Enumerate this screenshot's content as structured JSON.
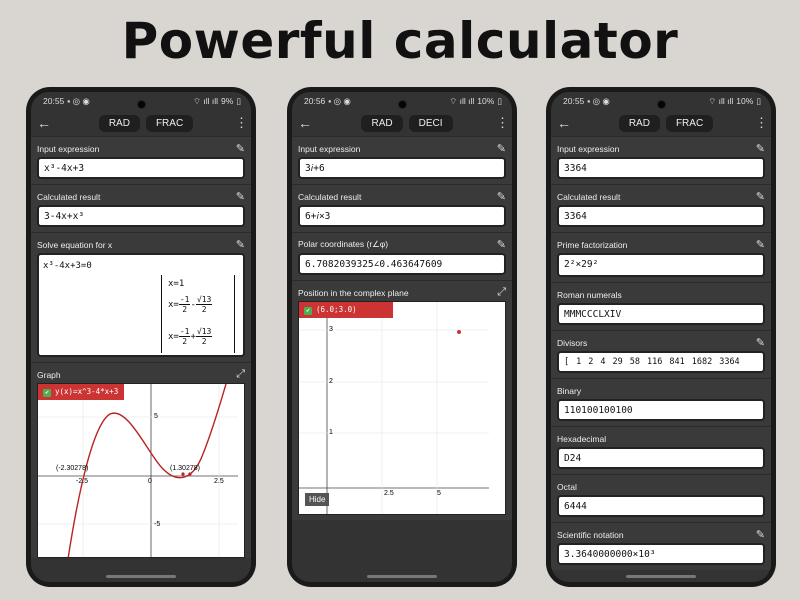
{
  "headline": "Powerful calculator",
  "phone1": {
    "status": {
      "time": "20:55",
      "battery": "9%"
    },
    "mode_buttons": [
      "RAD",
      "FRAC"
    ],
    "input_label": "Input expression",
    "input_value": "x³-4x+3",
    "result_label": "Calculated result",
    "result_value": "3-4x+x³",
    "solve_label": "Solve equation for x",
    "equation": "x³-4x+3=0",
    "solutions": {
      "x1": "x=1",
      "sqrt13": "13",
      "two": "2",
      "minus_one": "-1",
      "x_eq": "x="
    },
    "graph_label": "Graph",
    "graph_legend": "y(x)=x^3-4*x+3",
    "graph_ticks": {
      "x": [
        "-2.5",
        "0",
        "2.5"
      ],
      "y": [
        "5",
        "-5"
      ]
    },
    "graph_points": [
      "(-2.30278)",
      "(1.30278)"
    ]
  },
  "phone2": {
    "status": {
      "time": "20:56",
      "battery": "10%"
    },
    "mode_buttons": [
      "RAD",
      "DECI"
    ],
    "input_label": "Input expression",
    "input_value": "3𝑖+6",
    "result_label": "Calculated result",
    "result_value": "6+𝑖×3",
    "polar_label": "Polar coordinates (r∠φ)",
    "polar_value": "6.7082039325∠0.463647609",
    "plane_label": "Position in the complex plane",
    "plane_legend": "(6.0;3.0)",
    "plane_ticks": {
      "x": [
        "2.5",
        "5"
      ],
      "y": [
        "3",
        "2",
        "1"
      ]
    },
    "hide_button": "Hide"
  },
  "phone3": {
    "status": {
      "time": "20:55",
      "battery": "10%"
    },
    "mode_buttons": [
      "RAD",
      "FRAC"
    ],
    "input_label": "Input expression",
    "input_value": "3364",
    "result_label": "Calculated result",
    "result_value": "3364",
    "prime_label": "Prime factorization",
    "prime_value": "2²×29²",
    "roman_label": "Roman numerals",
    "roman_value": "MMMCCCLXIV",
    "divisors_label": "Divisors",
    "divisors": [
      "1",
      "2",
      "4",
      "29",
      "58",
      "116",
      "841",
      "1682",
      "3364"
    ],
    "binary_label": "Binary",
    "binary_value": "110100100100",
    "hex_label": "Hexadecimal",
    "hex_value": "D24",
    "octal_label": "Octal",
    "octal_value": "6444",
    "sci_label": "Scientific notation",
    "sci_value": "3.3640000000×10³"
  },
  "colors": {
    "accent": "#cc3333",
    "checkbox": "#4caf50",
    "panel": "#3a3a3a"
  }
}
